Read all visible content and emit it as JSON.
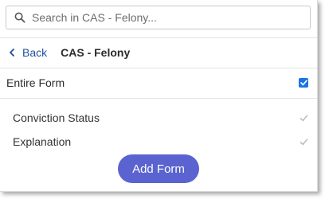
{
  "search": {
    "placeholder": "Search in CAS - Felony...",
    "value": ""
  },
  "nav": {
    "back_label": "Back",
    "title": "CAS - Felony"
  },
  "entire_form": {
    "label": "Entire Form",
    "checked": true
  },
  "fields": [
    {
      "label": "Conviction Status",
      "checked": true
    },
    {
      "label": "Explanation",
      "checked": true
    }
  ],
  "actions": {
    "add_label": "Add Form"
  },
  "colors": {
    "accent": "#5a63cf",
    "checkbox": "#1a73e8",
    "back_link": "#1f4f9e",
    "disabled_check": "#b5b5b5"
  },
  "icons": {
    "search": "search-icon",
    "back": "chevron-left-icon",
    "check": "checkmark-icon"
  }
}
